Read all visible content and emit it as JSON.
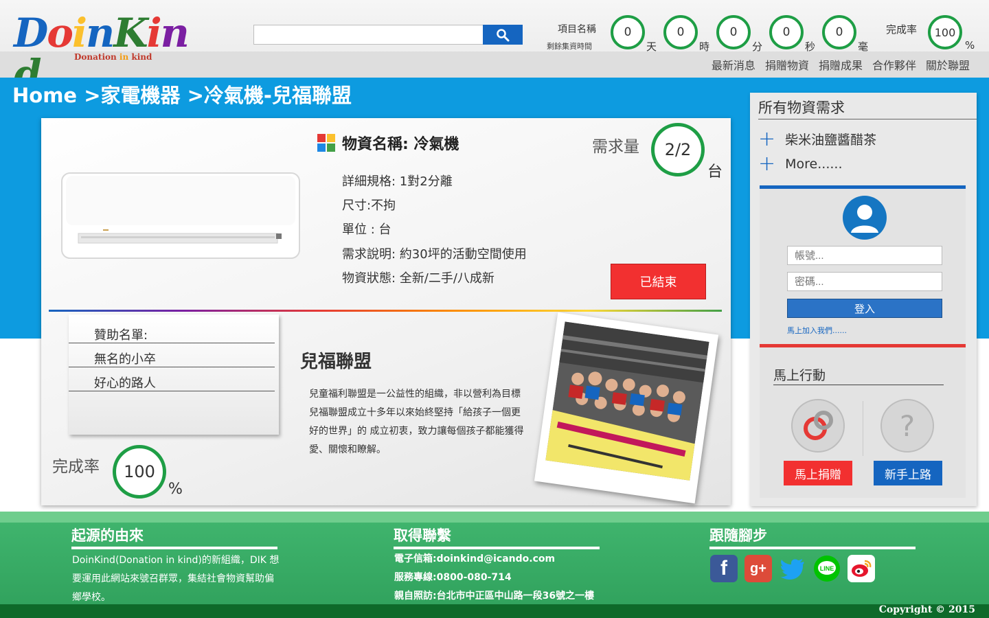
{
  "header": {
    "logo_text": "Doinkind",
    "logo_tagline_start": "Donation ",
    "logo_tagline_in": "in",
    "logo_tagline_end": " kind",
    "search": {
      "value": "",
      "placeholder": ""
    },
    "project_label": "項目名稱",
    "remaining_label": "剩餘集資時間",
    "countdown": [
      {
        "value": "0",
        "unit": "天"
      },
      {
        "value": "0",
        "unit": "時"
      },
      {
        "value": "0",
        "unit": "分"
      },
      {
        "value": "0",
        "unit": "秒"
      },
      {
        "value": "0",
        "unit": "毫"
      }
    ],
    "completion_label": "完成率",
    "completion_value": "100",
    "completion_unit": "%",
    "nav": [
      "最新消息",
      "捐贈物資",
      "捐贈成果",
      "合作夥伴",
      "關於聯盟"
    ]
  },
  "breadcrumb": {
    "home": "Home",
    "sep1": " >",
    "category": "家電機器",
    "sep2": " >",
    "item": "冷氣機-兒福聯盟"
  },
  "item": {
    "name": "物資名稱: 冷氣機",
    "specs": [
      "詳細規格: 1對2分離",
      "尺寸:不拘",
      "單位 : 台",
      "需求說明: 約30坪的活動空間使用",
      "物資狀態: 全新/二手/八成新"
    ],
    "demand_label": "需求量",
    "demand_value": "2/2",
    "demand_unit": "台",
    "status_button": "已結束"
  },
  "sponsors": {
    "title": "贊助名單:",
    "names": [
      "無名的小卒",
      "好心的路人"
    ]
  },
  "completion": {
    "label": "完成率",
    "value": "100",
    "unit": "%"
  },
  "organization": {
    "name": "兒福聯盟",
    "description_lines": [
      "兒童福利聯盟是一公益性的組織，非以營利為目標",
      "兒福聯盟成立十多年以來始終堅持「給孩子一個更",
      "好的世界」的 成立初衷，致力讓每個孩子都能獲得",
      "愛、關懷和瞭解。"
    ]
  },
  "sidebar": {
    "title": "所有物資需求",
    "items": [
      "柴米油鹽醬醋茶",
      "More......"
    ],
    "login": {
      "account_placeholder": "帳號...",
      "password_placeholder": "密碼...",
      "login_button": "登入",
      "join_link": "馬上加入我們......"
    },
    "action": {
      "title": "馬上行動",
      "donate_button": "馬上捐贈",
      "newbie_button": "新手上路"
    }
  },
  "footer": {
    "origin_title": "起源的由來",
    "origin_lines": [
      "DoinKind(Donation in kind)的新組織，DIK 想",
      "要運用此網站來號召群眾，集結社會物資幫助偏",
      "鄉學校。"
    ],
    "contact_title": "取得聯繫",
    "contact_lines": [
      "電子信箱:doinkind@icando.com",
      "服務專線:0800-080-714",
      "親自照訪:台北市中正區中山路一段36號之一樓"
    ],
    "follow_title": "跟隨腳步",
    "social": [
      "facebook-icon",
      "google-plus-icon",
      "twitter-icon",
      "line-icon",
      "weibo-icon"
    ],
    "copyright": "Copyright © 2015"
  },
  "colors": {
    "blue_band": "#0d9be0",
    "accent_green": "#1e9e45",
    "ended_red": "#f23030",
    "footer_green": "#34a862",
    "login_blue": "#2b73c6"
  }
}
